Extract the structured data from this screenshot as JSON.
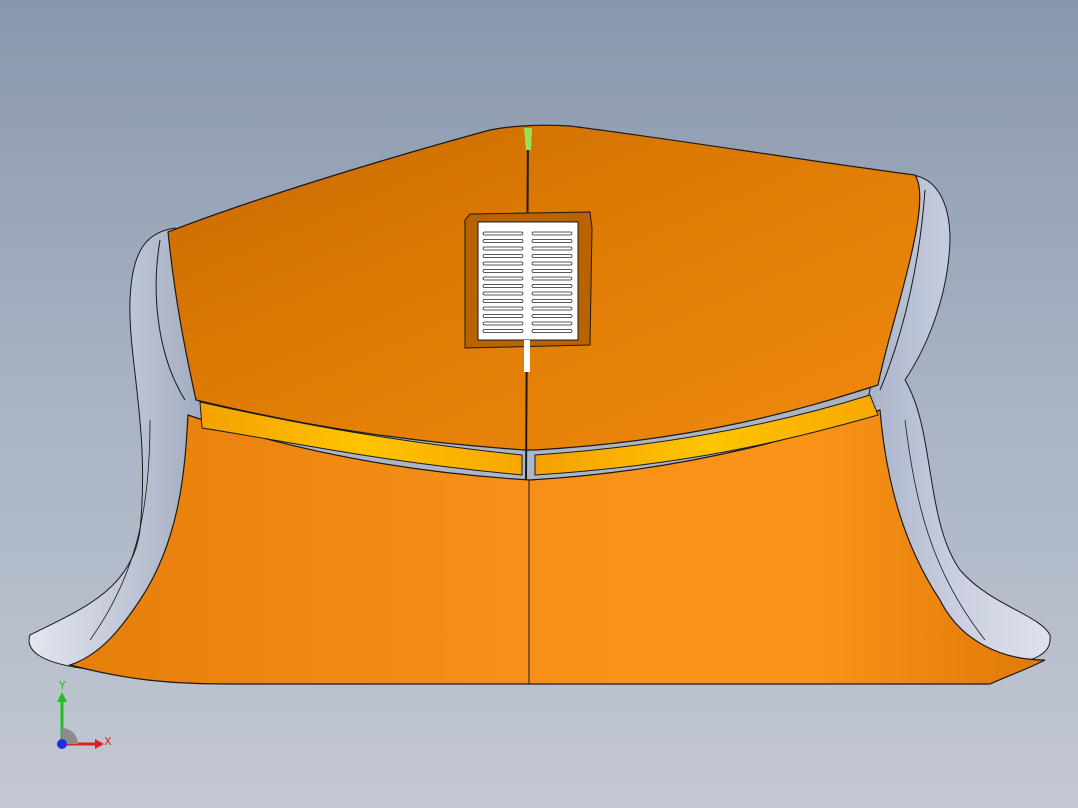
{
  "viewport": {
    "background_top": "#8997ad",
    "background_bottom": "#c3c8d3"
  },
  "model": {
    "name": "mouse",
    "body_color": "#f08a12",
    "highlight_color": "#ffc200",
    "side_grip_color": "#c9cfe0",
    "scroll_wheel_color": "#ffffff",
    "edge_color": "#1a1a1a"
  },
  "triad": {
    "x_label": "X",
    "y_label": "Y",
    "x_color": "#e02020",
    "y_color": "#20c020",
    "z_color": "#2030e0"
  }
}
